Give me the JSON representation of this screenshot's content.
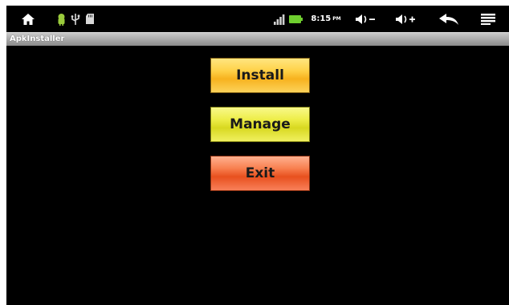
{
  "statusbar": {
    "time": "8:15",
    "ampm": "PM",
    "icons": [
      "home-icon",
      "android-icon",
      "usb-icon",
      "sd-card-icon",
      "wifi-signal-icon",
      "battery-icon",
      "volume-down-icon",
      "volume-up-icon",
      "back-icon",
      "menu-icon"
    ],
    "volume_down": "◀)−",
    "volume_up": "◀)+"
  },
  "app": {
    "title": "ApkInstaller"
  },
  "buttons": {
    "install": "Install",
    "manage": "Manage",
    "exit": "Exit"
  },
  "colors": {
    "install": "#f7b21e",
    "manage": "#d8d820",
    "exit": "#e8501e",
    "background": "#000000"
  }
}
